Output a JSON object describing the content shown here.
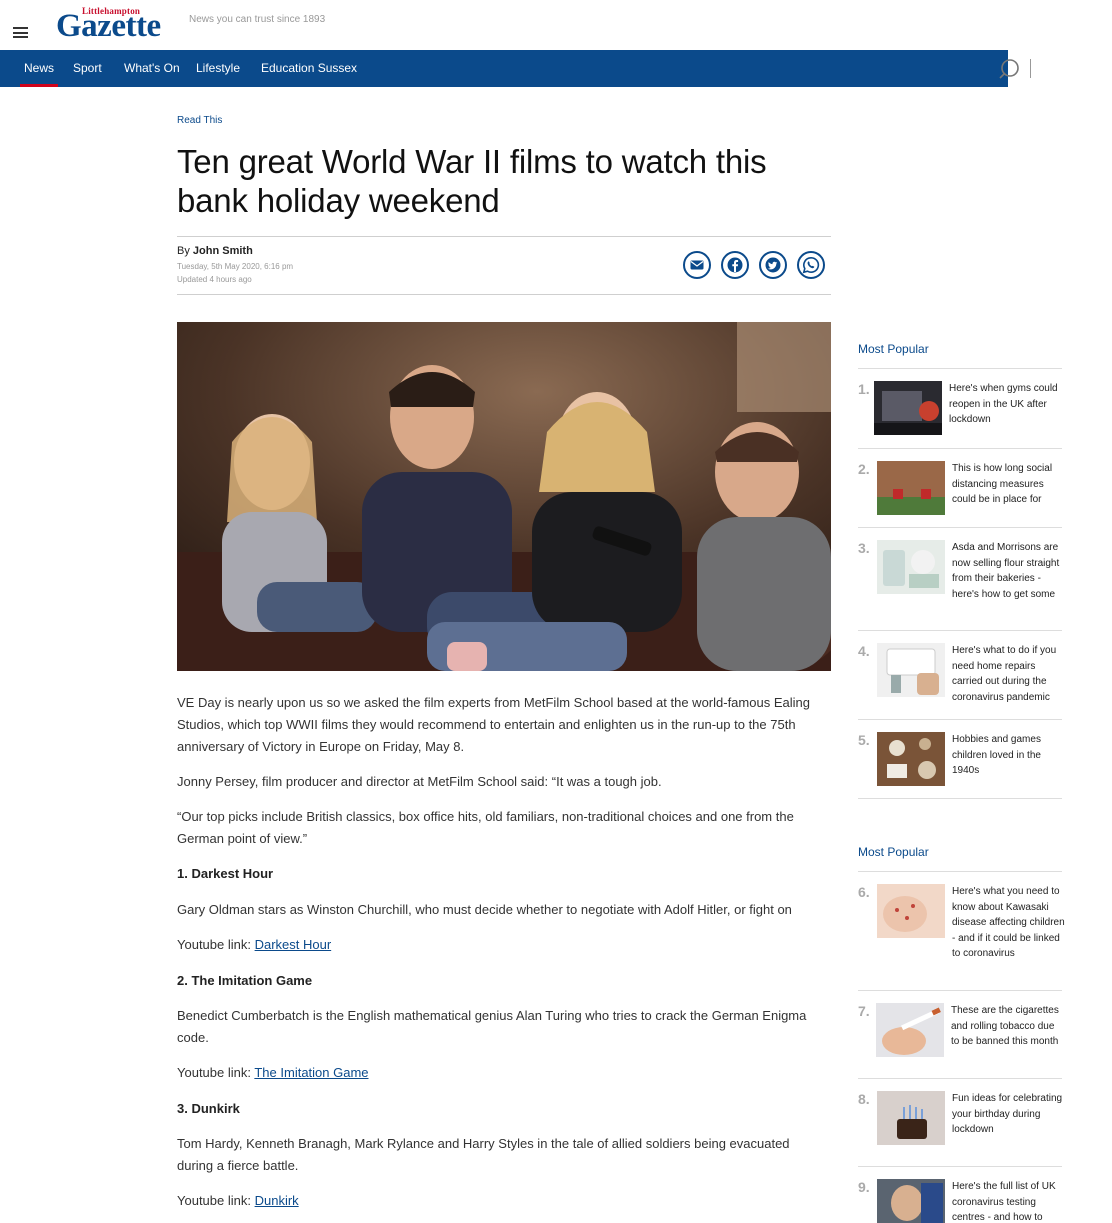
{
  "header": {
    "logo_small": "Littlehampton",
    "logo_big": "Gazette",
    "tagline": "News you can trust since 1893"
  },
  "nav": {
    "items": [
      {
        "label": "News",
        "active": true
      },
      {
        "label": "Sport"
      },
      {
        "label": "What's On"
      },
      {
        "label": "Lifestyle"
      },
      {
        "label": "Education Sussex"
      }
    ]
  },
  "article": {
    "kicker": "Read This",
    "headline": "Ten great World War II films to watch this bank holiday weekend",
    "byline_prefix": "By ",
    "author": "John Smith",
    "published": "Tuesday, 5th May 2020, 6:16 pm",
    "updated": "Updated  4 hours ago",
    "paragraphs": [
      "VE Day is nearly upon us so we asked the film experts from MetFilm School based at the world-famous Ealing Studios, which top WWII films they would recommend to entertain and enlighten us in the run-up to the 75th anniversary of Victory in Europe on Friday, May 8.",
      "Jonny Persey, film producer and director at MetFilm School said: “It was a tough job.",
      "“Our top picks include British classics, box office hits, old familiars, non-traditional choices and one from the German point of view.”"
    ],
    "films": [
      {
        "heading": "1. Darkest Hour",
        "desc": "Gary Oldman stars as Winston Churchill, who must decide whether to negotiate with Adolf Hitler, or fight on",
        "link_prefix": "Youtube link: ",
        "link": "Darkest Hour"
      },
      {
        "heading": "2. The Imitation Game",
        "desc": "Benedict Cumberbatch is the English mathematical genius Alan Turing who tries to crack the German Enigma code.",
        "link_prefix": "Youtube link: ",
        "link": "The Imitation Game"
      },
      {
        "heading": "3. Dunkirk",
        "desc": "Tom Hardy, Kenneth Branagh, Mark Rylance and Harry Styles in the tale of allied soldiers being evacuated during a fierce battle.",
        "link_prefix": "Youtube link: ",
        "link": "Dunkirk"
      }
    ]
  },
  "sidebar": {
    "heading1": "Most Popular",
    "heading2": "Most Popular",
    "items": [
      {
        "num": "1.",
        "title": "Here's when gyms could reopen in the UK after lockdown"
      },
      {
        "num": "2.",
        "title": "This is how long social distancing measures could be in place for"
      },
      {
        "num": "3.",
        "title": "Asda and Morrisons are now selling flour straight from their bakeries - here's how to get some"
      },
      {
        "num": "4.",
        "title": "Here's what to do if you need home repairs carried out during the coronavirus pandemic"
      },
      {
        "num": "5.",
        "title": "Hobbies and games children loved in the 1940s"
      },
      {
        "num": "6.",
        "title": "Here's what you need to know about Kawasaki disease affecting children - and if it could be linked to coronavirus"
      },
      {
        "num": "7.",
        "title": "These are the cigarettes and rolling tobacco due to be banned this month"
      },
      {
        "num": "8.",
        "title": "Fun ideas for celebrating your birthday during lockdown"
      },
      {
        "num": "9.",
        "title": "Here's the full list of UK coronavirus testing centres - and how to"
      }
    ]
  },
  "colors": {
    "brand_blue": "#0b4a8b",
    "accent_red": "#d0021b"
  },
  "icons": {
    "menu": "hamburger-icon",
    "search": "search-icon",
    "email": "email-icon",
    "facebook": "facebook-icon",
    "twitter": "twitter-icon",
    "whatsapp": "whatsapp-icon"
  }
}
